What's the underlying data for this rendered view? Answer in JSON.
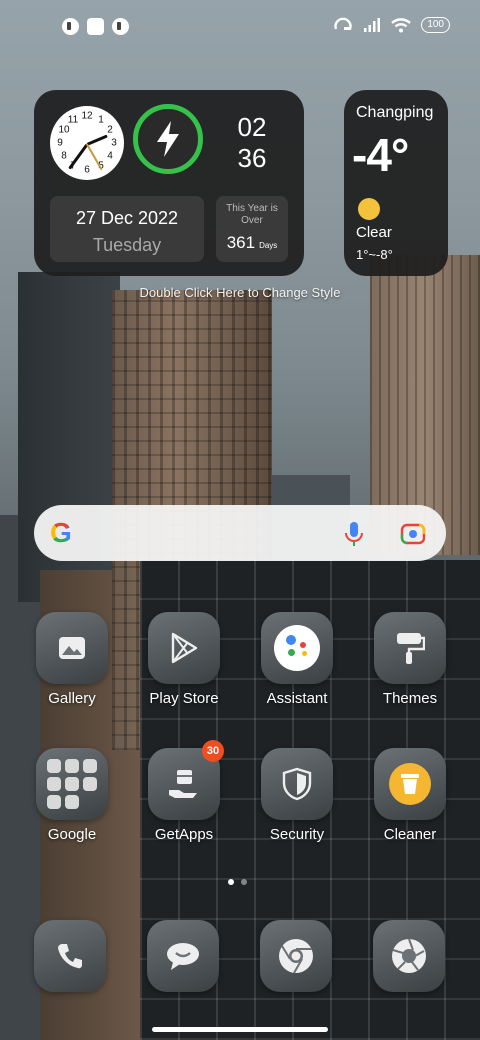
{
  "status_bar": {
    "left_icons": [
      "notification-icon-1",
      "notification-icon-2",
      "notification-icon-3"
    ],
    "right_icons": [
      "hotspot-icon",
      "signal-icon",
      "wifi-icon"
    ],
    "battery": "100"
  },
  "clock_widget": {
    "hour": "02",
    "minute": "36",
    "clock_numbers": [
      "12",
      "1",
      "2",
      "3",
      "4",
      "5",
      "6",
      "7",
      "8",
      "9",
      "10",
      "11"
    ],
    "date": "27 Dec 2022",
    "weekday": "Tuesday",
    "year_over_label": "This Year is Over",
    "year_over_days": "361",
    "year_over_unit": "Days",
    "charge_icon": "lightning-bolt-icon",
    "charge_ring_color": "#34c24a",
    "style_hint": "Double Click Here to Change Style"
  },
  "weather_widget": {
    "city": "Changping",
    "temperature": "-4°",
    "condition": "Clear",
    "range": "1°~-8°",
    "icon": "sun-icon"
  },
  "search": {
    "logo": "G",
    "icons": [
      "mic-icon",
      "lens-icon"
    ]
  },
  "apps": [
    {
      "label": "Gallery",
      "icon": "gallery-icon"
    },
    {
      "label": "Play Store",
      "icon": "play-store-icon"
    },
    {
      "label": "Assistant",
      "icon": "assistant-icon"
    },
    {
      "label": "Themes",
      "icon": "themes-icon"
    },
    {
      "label": "Google",
      "icon": "google-folder-icon"
    },
    {
      "label": "GetApps",
      "icon": "getapps-icon",
      "badge": "30"
    },
    {
      "label": "Security",
      "icon": "security-icon"
    },
    {
      "label": "Cleaner",
      "icon": "cleaner-icon"
    }
  ],
  "dock": [
    "phone-icon",
    "messages-icon",
    "chrome-icon",
    "camera-icon"
  ],
  "page_indicator": {
    "pages": 2,
    "active": 1
  }
}
